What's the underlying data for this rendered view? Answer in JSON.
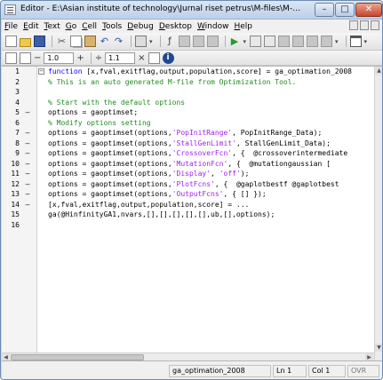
{
  "window": {
    "title": "Editor - E:\\Asian institute of technology\\Jurnal riset petrus\\M-files\\M-files\\My GA functions\\...",
    "min_label": "–",
    "max_label": "□",
    "close_label": "✕"
  },
  "menu": {
    "items": [
      {
        "first": "F",
        "rest": "ile"
      },
      {
        "first": "E",
        "rest": "dit"
      },
      {
        "first": "T",
        "rest": "ext"
      },
      {
        "first": "G",
        "rest": "o"
      },
      {
        "first": "C",
        "rest": "ell"
      },
      {
        "first": "T",
        "rest": "ools"
      },
      {
        "first": "D",
        "rest": "ebug"
      },
      {
        "first": "D",
        "rest": "esktop"
      },
      {
        "first": "W",
        "rest": "indow"
      },
      {
        "first": "H",
        "rest": "elp"
      }
    ]
  },
  "toolbar2": {
    "minus_label": "−",
    "step_value": "1.0",
    "plus_label": "+",
    "divide_label": "÷",
    "scale_value": "1.1",
    "times_label": "×"
  },
  "icons": {
    "cut": "cut-icon",
    "undo": "undo-icon",
    "redo": "redo-icon",
    "find": "find-icon",
    "run": "run-icon",
    "info": "info-icon"
  },
  "glyphs": {
    "cut": "✂",
    "undo": "↶",
    "redo": "↷",
    "find": "ƒ",
    "run": "▶",
    "info": "i",
    "dropdown": "▾",
    "fold": "−"
  },
  "code_lines": [
    {
      "n": "1",
      "mark": "",
      "fold": true,
      "segs": [
        {
          "t": "function",
          "c": "kw"
        },
        {
          "t": " [x,fval,exitflag,output,population,score] = ga_optimation_2008",
          "c": ""
        }
      ]
    },
    {
      "n": "2",
      "mark": "",
      "fold": false,
      "segs": [
        {
          "t": "% This is an auto generated M-file from Optimization Tool.",
          "c": "cm"
        }
      ]
    },
    {
      "n": "3",
      "mark": "",
      "fold": false,
      "segs": []
    },
    {
      "n": "4",
      "mark": "",
      "fold": false,
      "segs": [
        {
          "t": "% Start with the default options",
          "c": "cm"
        }
      ]
    },
    {
      "n": "5",
      "mark": "–",
      "fold": false,
      "segs": [
        {
          "t": "options = gaoptimset;",
          "c": ""
        }
      ]
    },
    {
      "n": "6",
      "mark": "",
      "fold": false,
      "segs": [
        {
          "t": "% Modify options setting",
          "c": "cm"
        }
      ]
    },
    {
      "n": "7",
      "mark": "–",
      "fold": false,
      "segs": [
        {
          "t": "options = gaoptimset(options,",
          "c": ""
        },
        {
          "t": "'PopInitRange'",
          "c": "str"
        },
        {
          "t": ", PopInitRange_Data);",
          "c": ""
        }
      ]
    },
    {
      "n": "8",
      "mark": "–",
      "fold": false,
      "segs": [
        {
          "t": "options = gaoptimset(options,",
          "c": ""
        },
        {
          "t": "'StallGenLimit'",
          "c": "str"
        },
        {
          "t": ", StallGenLimit_Data);",
          "c": ""
        }
      ]
    },
    {
      "n": "9",
      "mark": "–",
      "fold": false,
      "segs": [
        {
          "t": "options = gaoptimset(options,",
          "c": ""
        },
        {
          "t": "'CrossoverFcn'",
          "c": "str"
        },
        {
          "t": ", {  @crossoverintermediate",
          "c": ""
        }
      ]
    },
    {
      "n": "10",
      "mark": "–",
      "fold": false,
      "segs": [
        {
          "t": "options = gaoptimset(options,",
          "c": ""
        },
        {
          "t": "'MutationFcn'",
          "c": "str"
        },
        {
          "t": ", {  @mutationgaussian [",
          "c": ""
        }
      ]
    },
    {
      "n": "11",
      "mark": "–",
      "fold": false,
      "segs": [
        {
          "t": "options = gaoptimset(options,",
          "c": ""
        },
        {
          "t": "'Display'",
          "c": "str"
        },
        {
          "t": ", ",
          "c": ""
        },
        {
          "t": "'off'",
          "c": "str"
        },
        {
          "t": ");",
          "c": ""
        }
      ]
    },
    {
      "n": "12",
      "mark": "–",
      "fold": false,
      "segs": [
        {
          "t": "options = gaoptimset(options,",
          "c": ""
        },
        {
          "t": "'PlotFcns'",
          "c": "str"
        },
        {
          "t": ", {  @gaplotbestf @gaplotbest",
          "c": ""
        }
      ]
    },
    {
      "n": "13",
      "mark": "–",
      "fold": false,
      "segs": [
        {
          "t": "options = gaoptimset(options,",
          "c": ""
        },
        {
          "t": "'OutputFcns'",
          "c": "str"
        },
        {
          "t": ", { [] });",
          "c": ""
        }
      ]
    },
    {
      "n": "14",
      "mark": "–",
      "fold": false,
      "segs": [
        {
          "t": "[x,fval,exitflag,output,population,score] = ...",
          "c": ""
        }
      ]
    },
    {
      "n": "15",
      "mark": "",
      "fold": false,
      "segs": [
        {
          "t": "ga(@HinfinityGA1,nvars,[],[],[],[],[],ub,[],options);",
          "c": ""
        }
      ]
    },
    {
      "n": "16",
      "mark": "",
      "fold": false,
      "segs": []
    }
  ],
  "status": {
    "function_name": "ga_optimation_2008",
    "line": "Ln  1",
    "col": "Col  1",
    "mode": "OVR"
  }
}
